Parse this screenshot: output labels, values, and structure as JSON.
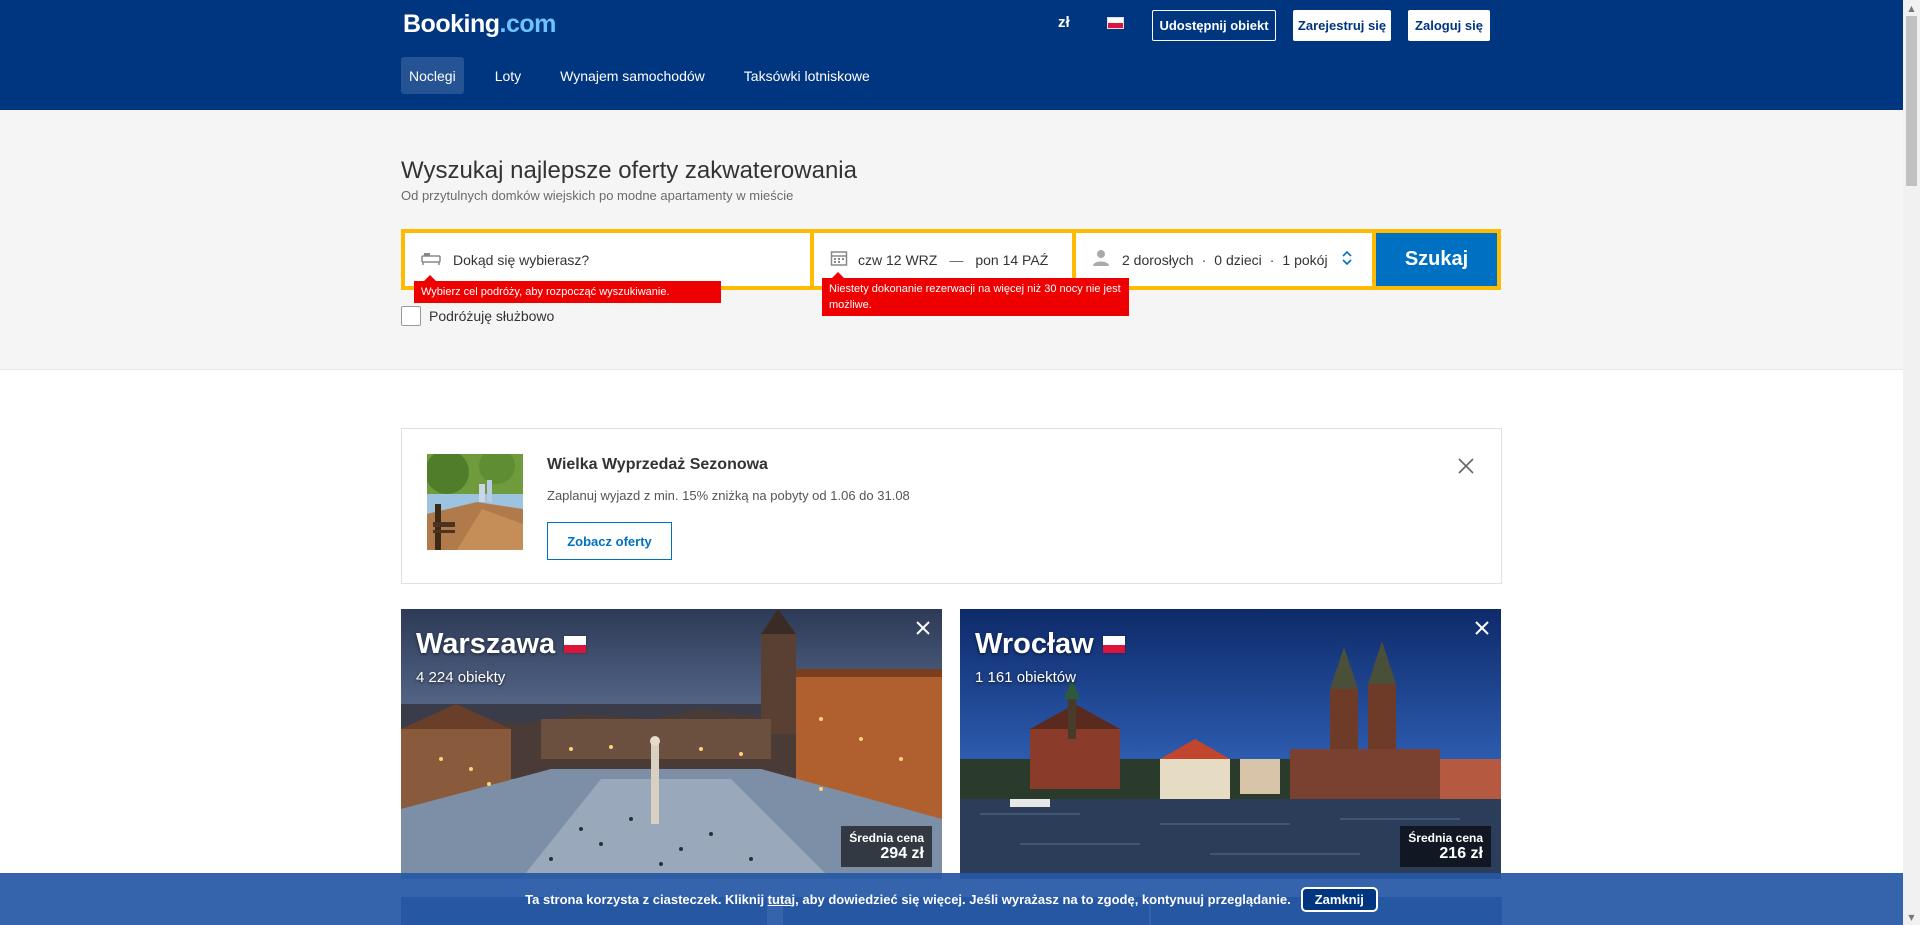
{
  "header": {
    "logo_main": "Booking",
    "logo_suffix": ".com",
    "currency": "zł",
    "list_property": "Udostępnij obiekt",
    "register": "Zarejestruj się",
    "login": "Zaloguj się"
  },
  "nav": {
    "items": [
      {
        "label": "Noclegi",
        "active": true
      },
      {
        "label": "Loty"
      },
      {
        "label": "Wynajem samochodów"
      },
      {
        "label": "Taksówki lotniskowe"
      }
    ]
  },
  "search": {
    "title": "Wyszukaj najlepsze oferty zakwaterowania",
    "subtitle": "Od przytulnych domków wiejskich po modne apartamenty w mieście",
    "destination_placeholder": "Dokąd się wybierasz?",
    "checkin": "czw 12 WRZ",
    "dash": "—",
    "checkout": "pon 14 PAŹ",
    "adults": "2 dorosłych",
    "children": "0 dzieci",
    "rooms": "1 pokój",
    "sep": "·",
    "button": "Szukaj",
    "error_destination": "Wybierz cel podróży, aby rozpocząć wyszukiwanie.",
    "error_dates": "Niestety dokonanie rezerwacji na więcej niż 30 nocy nie jest możliwe.",
    "business_travel": "Podróżuję służbowo"
  },
  "promo": {
    "title": "Wielka Wyprzedaż Sezonowa",
    "text": "Zaplanuj wyjazd z min. 15% zniżką na pobyty od 1.06 do 31.08",
    "button": "Zobacz oferty"
  },
  "cities": [
    {
      "name": "Warszawa",
      "count": "4 224 obiekty",
      "price_label": "Średnia cena",
      "price": "294 zł"
    },
    {
      "name": "Wrocław",
      "count": "1 161 obiektów",
      "price_label": "Średnia cena",
      "price": "216 zł"
    }
  ],
  "cookie": {
    "text_before": "Ta strona korzysta z ciasteczek. Kliknij ",
    "link": "tutaj",
    "text_after": ", aby dowiedzieć się więcej. Jeśli wyrażasz na to zgodę, kontynuuj przeglądanie.",
    "button": "Zamknij"
  },
  "colors": {
    "brand_blue": "#003580",
    "accent_blue": "#0071c2",
    "search_yellow": "#febb02",
    "error_red": "#e00000"
  }
}
